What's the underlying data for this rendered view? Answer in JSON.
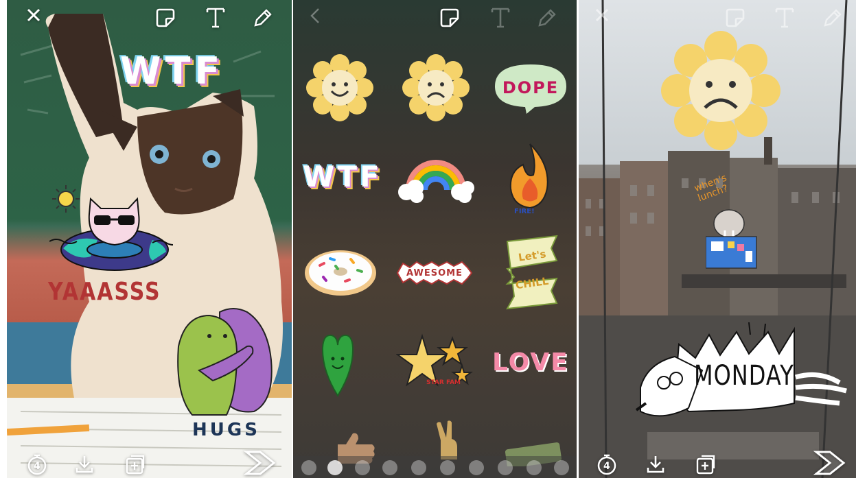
{
  "panel1": {
    "wtf_text": "WTF",
    "yaaasss_text": "YAAASSS",
    "hugs_text": "HUGS",
    "timer_value": "4"
  },
  "panel2": {
    "stickers": {
      "dope": "DOPE",
      "wtf": "WTF",
      "fire": "FIRE!",
      "awesome": "AWESOME",
      "lets_chill_1": "Let's",
      "lets_chill_2": "CHILL",
      "love": "LOVE",
      "star_label": "STAR FAM"
    }
  },
  "panel3": {
    "whens_lunch": "when's lunch?",
    "monday_text": "MONDAY",
    "timer_value": "4"
  },
  "colors": {
    "sticker_yellow": "#f5d36b",
    "sticker_green": "#cfe9c6",
    "fire_orange": "#f29b2b",
    "love_pink": "#f48aa8",
    "text_red": "#b23434"
  }
}
